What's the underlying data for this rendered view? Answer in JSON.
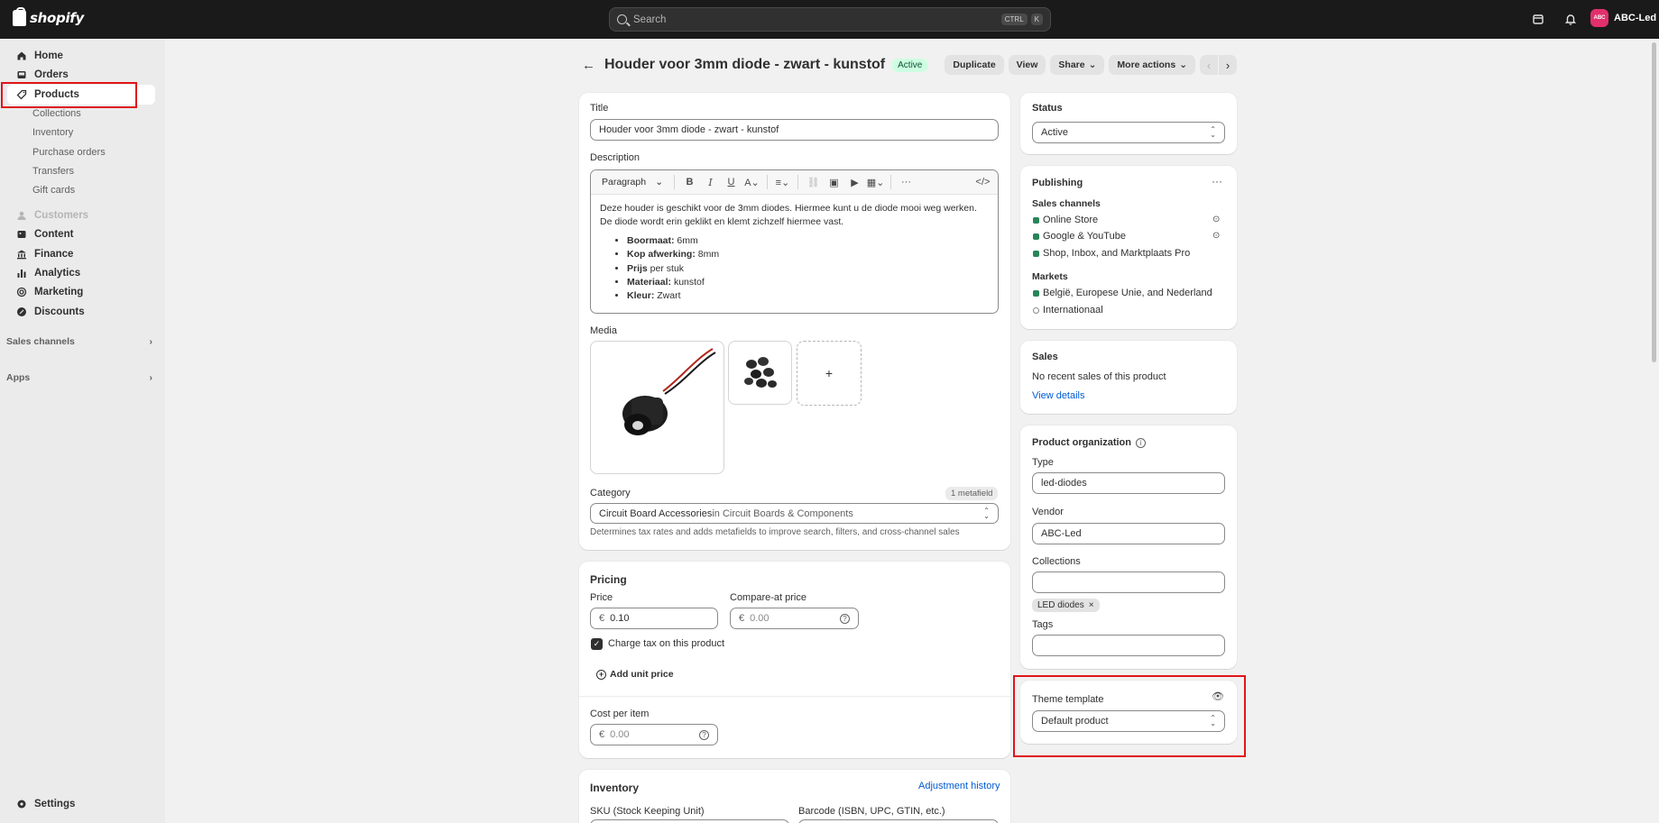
{
  "topbar": {
    "logo_text": "shopify",
    "search_placeholder": "Search",
    "kbd1": "CTRL",
    "kbd2": "K",
    "account_initials": "ABC",
    "account_name": "ABC-Led"
  },
  "sidebar": {
    "items": [
      {
        "label": "Home"
      },
      {
        "label": "Orders"
      },
      {
        "label": "Products"
      },
      {
        "label": "Customers"
      },
      {
        "label": "Content"
      },
      {
        "label": "Finance"
      },
      {
        "label": "Analytics"
      },
      {
        "label": "Marketing"
      },
      {
        "label": "Discounts"
      }
    ],
    "sub_items": [
      "Collections",
      "Inventory",
      "Purchase orders",
      "Transfers",
      "Gift cards"
    ],
    "sales_channels": "Sales channels",
    "apps": "Apps",
    "settings": "Settings"
  },
  "header": {
    "title": "Houder voor 3mm diode - zwart - kunstof",
    "status_badge": "Active",
    "duplicate": "Duplicate",
    "view": "View",
    "share": "Share",
    "more_actions": "More actions"
  },
  "product": {
    "title_label": "Title",
    "title_value": "Houder voor 3mm diode - zwart - kunstof",
    "description_label": "Description",
    "toolbar_paragraph": "Paragraph",
    "description_text": "Deze houder is geschikt voor de 3mm diodes. Hiermee kunt u de diode mooi weg werken. De diode wordt erin geklikt en klemt zichzelf hiermee vast.",
    "bullets": [
      {
        "key": "Boormaat:",
        "value": " 6mm"
      },
      {
        "key": "Kop afwerking:",
        "value": " 8mm"
      },
      {
        "key": "Prijs",
        "value": " per stuk"
      },
      {
        "key": "Materiaal:",
        "value": " kunstof"
      },
      {
        "key": "Kleur:",
        "value": " Zwart"
      }
    ],
    "media_label": "Media",
    "media_add": "+",
    "category_label": "Category",
    "metafield_badge": "1 metafield",
    "category_main": "Circuit Board Accessories",
    "category_in": " in Circuit Boards & Components",
    "category_help": "Determines tax rates and adds metafields to improve search, filters, and cross-channel sales"
  },
  "pricing": {
    "heading": "Pricing",
    "price_label": "Price",
    "currency": "€",
    "price_value": "0.10",
    "compare_label": "Compare-at price",
    "compare_placeholder": "0.00",
    "charge_tax": "Charge tax on this product",
    "add_unit_price": "Add unit price",
    "cost_label": "Cost per item",
    "cost_placeholder": "0.00"
  },
  "inventory": {
    "heading": "Inventory",
    "adjustment_history": "Adjustment history",
    "sku_label": "SKU (Stock Keeping Unit)",
    "barcode_label": "Barcode (ISBN, UPC, GTIN, etc.)"
  },
  "status_card": {
    "heading": "Status",
    "value": "Active"
  },
  "publishing": {
    "heading": "Publishing",
    "sales_channels_label": "Sales channels",
    "channels": [
      "Online Store",
      "Google & YouTube",
      "Shop, Inbox, and Marktplaats Pro"
    ],
    "markets_label": "Markets",
    "markets": [
      "België, Europese Unie, and Nederland",
      "Internationaal"
    ]
  },
  "sales": {
    "heading": "Sales",
    "text": "No recent sales of this product",
    "link": "View details"
  },
  "organization": {
    "heading": "Product organization",
    "type_label": "Type",
    "type_value": "led-diodes",
    "vendor_label": "Vendor",
    "vendor_value": "ABC-Led",
    "collections_label": "Collections",
    "collection_tag": "LED diodes",
    "tags_label": "Tags"
  },
  "theme": {
    "heading": "Theme template",
    "value": "Default product"
  },
  "colors": {
    "accent": "#005bd3",
    "success": "#29845a",
    "highlight": "#e0151b"
  }
}
